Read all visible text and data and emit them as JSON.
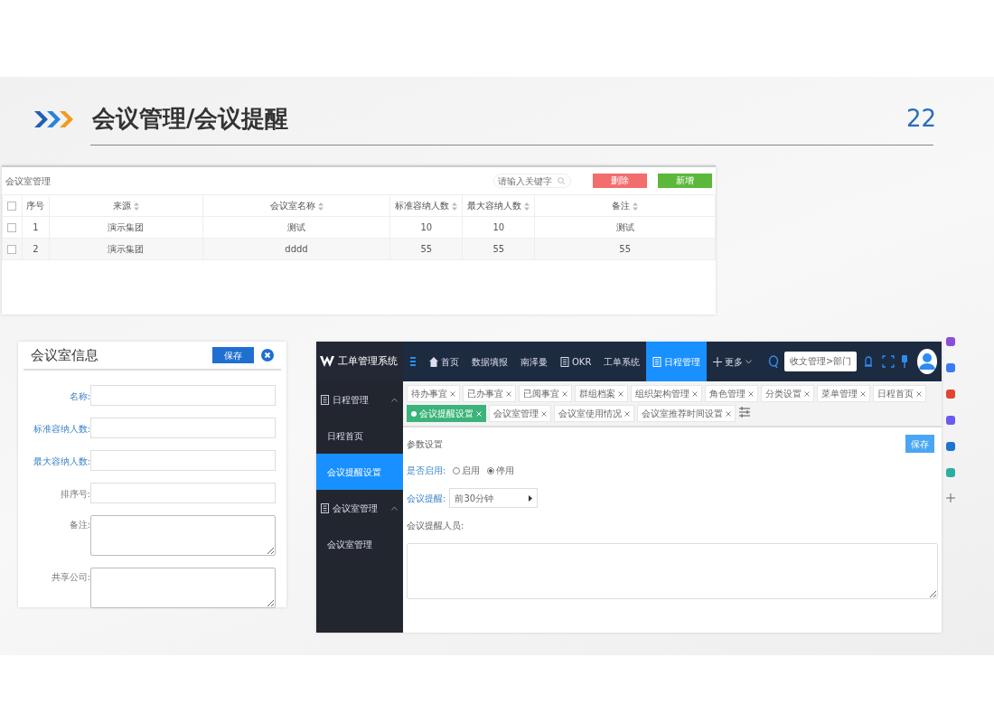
{
  "slide": {
    "title": "会议管理/会议提醒",
    "page_number": "22"
  },
  "room_list": {
    "title": "会议室管理",
    "search": {
      "placeholder": "请输入关键字"
    },
    "buttons": [
      {
        "label": "删除",
        "kind": "danger"
      },
      {
        "label": "新增",
        "kind": "success"
      }
    ],
    "table": {
      "all_checked": false,
      "columns": [
        {
          "label": "序号",
          "sortable": false
        },
        {
          "label": "来源",
          "sortable": true
        },
        {
          "label": "会议室名称",
          "sortable": true
        },
        {
          "label": "标准容纳人数",
          "sortable": true
        },
        {
          "label": "最大容纳人数",
          "sortable": true
        },
        {
          "label": "备注",
          "sortable": true
        }
      ],
      "rows": [
        {
          "checked": false,
          "cells": [
            "1",
            "演示集团",
            "测试",
            "10",
            "10",
            "测试"
          ]
        },
        {
          "checked": false,
          "cells": [
            "2",
            "演示集团",
            "dddd",
            "55",
            "55",
            "55"
          ]
        }
      ]
    }
  },
  "room_form": {
    "title": "会议室信息",
    "save_button": "保存",
    "fields": [
      {
        "label": "名称:",
        "kind": "input",
        "required": true
      },
      {
        "label": "标准容纳人数:",
        "kind": "input",
        "required": true
      },
      {
        "label": "最大容纳人数:",
        "kind": "input",
        "required": true
      },
      {
        "label": "排序号:",
        "kind": "input",
        "required": false
      },
      {
        "label": "备注:",
        "kind": "textarea",
        "required": false
      },
      {
        "label": "共享公司:",
        "kind": "textarea",
        "required": false
      }
    ]
  },
  "app": {
    "brand": "工单管理系统",
    "nav": [
      {
        "label": "首页",
        "kind": "home",
        "selected": false
      },
      {
        "label": "数据填报",
        "kind": "plain",
        "selected": false
      },
      {
        "label": "南泽曼",
        "kind": "plain",
        "selected": false
      },
      {
        "label": "OKR",
        "kind": "doc",
        "selected": false
      },
      {
        "label": "工单系统",
        "kind": "plain",
        "selected": false
      },
      {
        "label": "日程管理",
        "kind": "doc",
        "selected": true
      },
      {
        "label": "更多",
        "kind": "more",
        "selected": false
      }
    ],
    "search_field": {
      "value": "收文管理>部门"
    },
    "tabs": [
      {
        "label": "待办事宜",
        "selected": false
      },
      {
        "label": "已办事宜",
        "selected": false
      },
      {
        "label": "已阅事宜",
        "selected": false
      },
      {
        "label": "群组档案",
        "selected": false
      },
      {
        "label": "组织架构管理",
        "selected": false
      },
      {
        "label": "角色管理",
        "selected": false
      },
      {
        "label": "分类设置",
        "selected": false
      },
      {
        "label": "菜单管理",
        "selected": false
      },
      {
        "label": "日程首页",
        "selected": false
      },
      {
        "label": "会议提醒设置",
        "selected": true
      },
      {
        "label": "会议室管理",
        "selected": false
      },
      {
        "label": "会议室使用情况",
        "selected": false
      },
      {
        "label": "会议室推荐时间设置",
        "selected": false
      }
    ],
    "sidebar": [
      {
        "label": "日程管理",
        "kind": "group",
        "expanded": true,
        "selected": false
      },
      {
        "label": "日程首页",
        "kind": "item",
        "selected": false
      },
      {
        "label": "会议提醒设置",
        "kind": "item",
        "selected": true
      },
      {
        "label": "会议室管理",
        "kind": "group",
        "expanded": true,
        "selected": false
      },
      {
        "label": "会议室管理",
        "kind": "item",
        "selected": false
      }
    ],
    "content": {
      "title": "参数设置",
      "save_button": "保存",
      "enable": {
        "label": "是否启用:",
        "required": true,
        "options": [
          {
            "label": "启用",
            "selected": false
          },
          {
            "label": "停用",
            "selected": true
          }
        ]
      },
      "reminder": {
        "label": "会议提醒:",
        "required": true,
        "value": "前30分钟"
      },
      "recipients": {
        "label": "会议提醒人员:",
        "required": false
      }
    }
  }
}
